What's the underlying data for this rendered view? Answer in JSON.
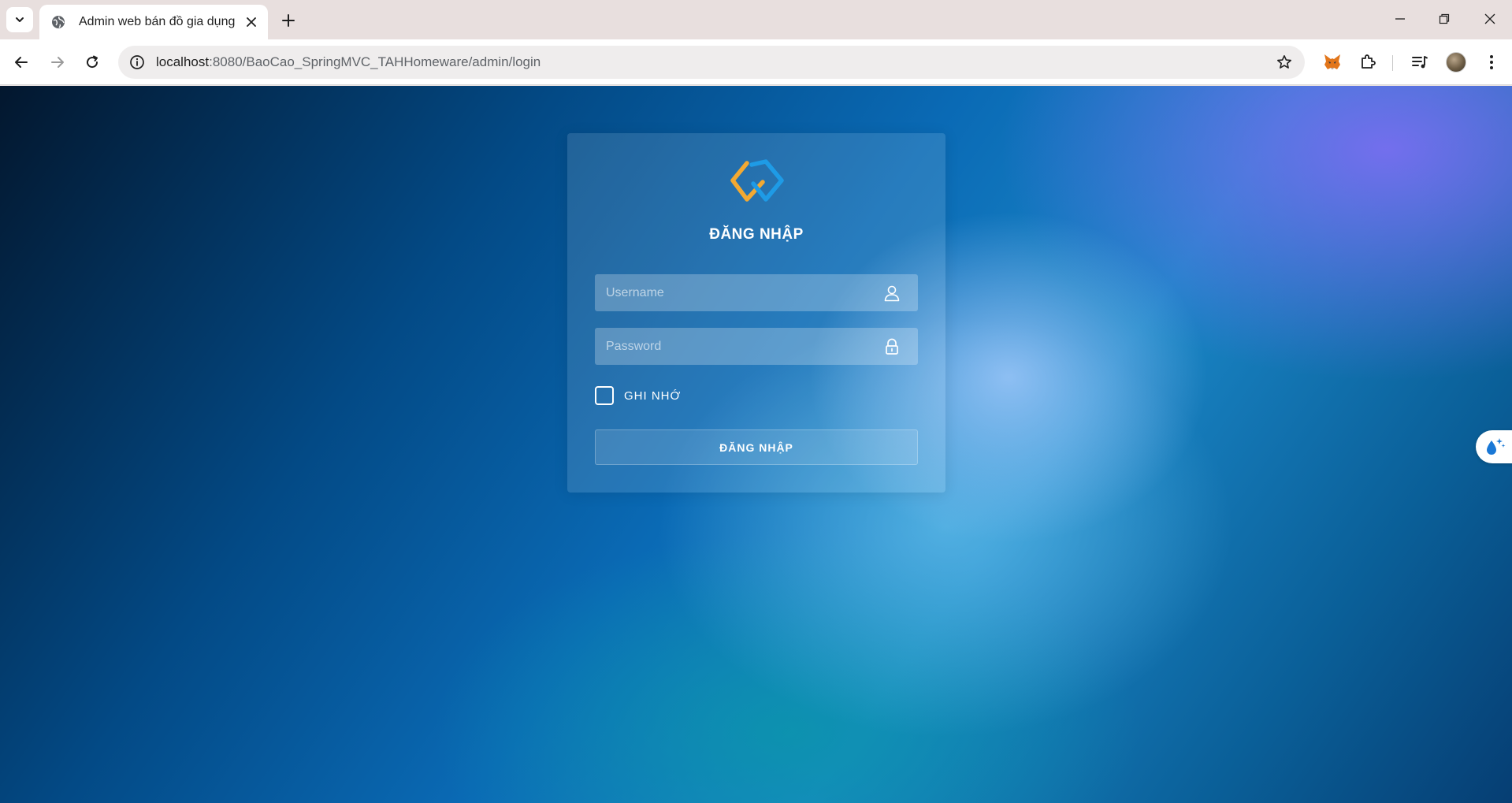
{
  "browser": {
    "tab": {
      "title": "Admin web bán đồ gia dụng",
      "favicon": "globe-icon"
    },
    "address_bar": {
      "host": "localhost",
      "path": ":8080/BaoCao_SpringMVC_TAHHomeware/admin/login"
    },
    "icons": {
      "tab_search": "chevron-down-icon",
      "new_tab": "plus-icon",
      "back": "arrow-left-icon",
      "forward": "arrow-right-icon",
      "reload": "reload-icon",
      "site_info": "info-icon",
      "bookmark": "star-icon",
      "extension_1": "metamask-fox-icon",
      "extensions": "puzzle-icon",
      "media": "playlist-icon",
      "profile": "avatar",
      "menu": "kebab-icon"
    }
  },
  "login": {
    "heading": "ĐĂNG NHẬP",
    "username_placeholder": "Username",
    "password_placeholder": "Password",
    "remember_label": "GHI NHỚ",
    "submit_label": "ĐĂNG NHẬP"
  },
  "colors": {
    "logo_left": "#f3a932",
    "logo_right": "#1e9be6",
    "text_on_card": "#ffffff"
  }
}
